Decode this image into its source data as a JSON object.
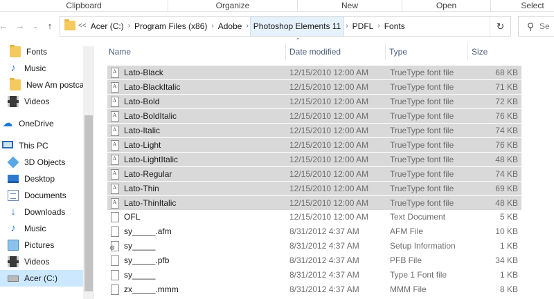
{
  "ribbon": {
    "groups": [
      "Clipboard",
      "Organize",
      "New",
      "Open",
      "Select"
    ]
  },
  "nav": {
    "back_icon": "arrow-left-icon",
    "forward_icon": "arrow-right-icon",
    "recent_icon": "chevron-down-icon",
    "up_icon": "arrow-up-icon"
  },
  "address": {
    "overflow": "<<",
    "crumbs": [
      "Acer (C:)",
      "Program Files (x86)",
      "Adobe",
      "Photoshop Elements 11",
      "PDFL",
      "Fonts"
    ],
    "highlighted_index": 3,
    "refresh_icon": "refresh-icon"
  },
  "search": {
    "placeholder": "Se"
  },
  "navpane": {
    "items": [
      {
        "label": "Fonts",
        "icon": "folder-icon"
      },
      {
        "label": "Music",
        "icon": "music-icon"
      },
      {
        "label": "New Am postcar",
        "icon": "folder-icon"
      },
      {
        "label": "Videos",
        "icon": "video-icon"
      },
      {
        "label": "OneDrive",
        "icon": "cloud-icon"
      },
      {
        "label": "This PC",
        "icon": "computer-icon"
      },
      {
        "label": "3D Objects",
        "icon": "cube-icon"
      },
      {
        "label": "Desktop",
        "icon": "desktop-icon"
      },
      {
        "label": "Documents",
        "icon": "document-icon"
      },
      {
        "label": "Downloads",
        "icon": "download-icon"
      },
      {
        "label": "Music",
        "icon": "music-icon"
      },
      {
        "label": "Pictures",
        "icon": "picture-icon"
      },
      {
        "label": "Videos",
        "icon": "video-icon"
      },
      {
        "label": "Acer (C:)",
        "icon": "drive-icon"
      }
    ],
    "selected_index": 13
  },
  "columns": {
    "name": "Name",
    "date": "Date modified",
    "type": "Type",
    "size": "Size"
  },
  "files": [
    {
      "name": "Lato-Black",
      "date": "12/15/2010 12:00 AM",
      "type": "TrueType font file",
      "size": "68 KB",
      "selected": true,
      "icon": "font"
    },
    {
      "name": "Lato-BlackItalic",
      "date": "12/15/2010 12:00 AM",
      "type": "TrueType font file",
      "size": "71 KB",
      "selected": true,
      "icon": "font"
    },
    {
      "name": "Lato-Bold",
      "date": "12/15/2010 12:00 AM",
      "type": "TrueType font file",
      "size": "72 KB",
      "selected": true,
      "icon": "font"
    },
    {
      "name": "Lato-BoldItalic",
      "date": "12/15/2010 12:00 AM",
      "type": "TrueType font file",
      "size": "76 KB",
      "selected": true,
      "icon": "font"
    },
    {
      "name": "Lato-Italic",
      "date": "12/15/2010 12:00 AM",
      "type": "TrueType font file",
      "size": "74 KB",
      "selected": true,
      "icon": "font"
    },
    {
      "name": "Lato-Light",
      "date": "12/15/2010 12:00 AM",
      "type": "TrueType font file",
      "size": "76 KB",
      "selected": true,
      "icon": "font"
    },
    {
      "name": "Lato-LightItalic",
      "date": "12/15/2010 12:00 AM",
      "type": "TrueType font file",
      "size": "48 KB",
      "selected": true,
      "icon": "font"
    },
    {
      "name": "Lato-Regular",
      "date": "12/15/2010 12:00 AM",
      "type": "TrueType font file",
      "size": "74 KB",
      "selected": true,
      "icon": "font"
    },
    {
      "name": "Lato-Thin",
      "date": "12/15/2010 12:00 AM",
      "type": "TrueType font file",
      "size": "69 KB",
      "selected": true,
      "icon": "font"
    },
    {
      "name": "Lato-ThinItalic",
      "date": "12/15/2010 12:00 AM",
      "type": "TrueType font file",
      "size": "48 KB",
      "selected": true,
      "icon": "font"
    },
    {
      "name": "OFL",
      "date": "12/15/2010 12:00 AM",
      "type": "Text Document",
      "size": "5 KB",
      "selected": false,
      "icon": "text"
    },
    {
      "name": "sy_____.afm",
      "date": "8/31/2012 4:37 AM",
      "type": "AFM File",
      "size": "10 KB",
      "selected": false,
      "icon": "file"
    },
    {
      "name": "sy_____",
      "date": "8/31/2012 4:37 AM",
      "type": "Setup Information",
      "size": "1 KB",
      "selected": false,
      "icon": "setup"
    },
    {
      "name": "sy_____.pfb",
      "date": "8/31/2012 4:37 AM",
      "type": "PFB File",
      "size": "34 KB",
      "selected": false,
      "icon": "file"
    },
    {
      "name": "sy_____",
      "date": "8/31/2012 4:37 AM",
      "type": "Type 1 Font file",
      "size": "1 KB",
      "selected": false,
      "icon": "file"
    },
    {
      "name": "zx_____.mmm",
      "date": "8/31/2012 4:37 AM",
      "type": "MMM File",
      "size": "8 KB",
      "selected": false,
      "icon": "file"
    }
  ]
}
